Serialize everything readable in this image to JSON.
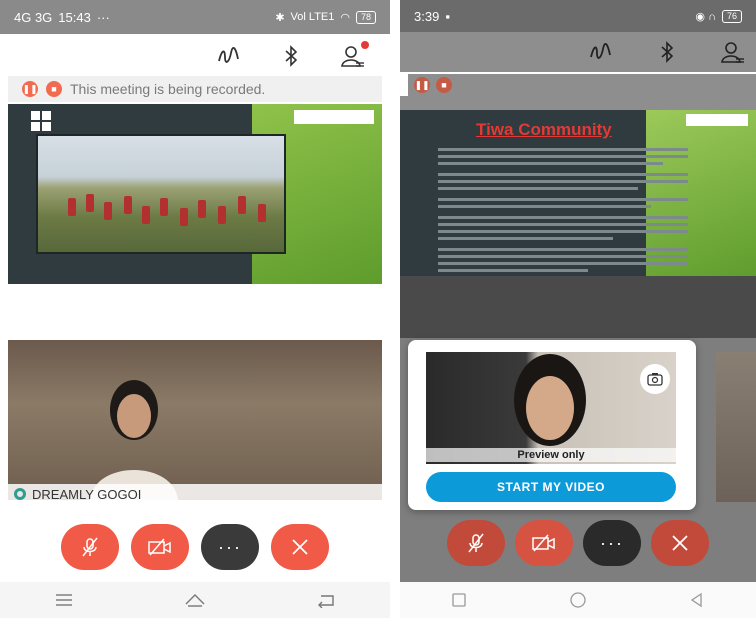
{
  "left": {
    "status": {
      "network": "4G 3G",
      "time": "15:43",
      "more": "···",
      "right": "Vol LTE1",
      "battery": "78"
    },
    "recording_text": "This meeting is being recorded.",
    "participant_name": "DREAMLY GOGOI"
  },
  "right": {
    "status": {
      "time": "3:39",
      "battery": "76"
    },
    "slide_title": "Tiwa Community",
    "preview_label": "Preview only",
    "start_video_label": "START MY VIDEO"
  },
  "controls": {
    "more_label": "···"
  }
}
